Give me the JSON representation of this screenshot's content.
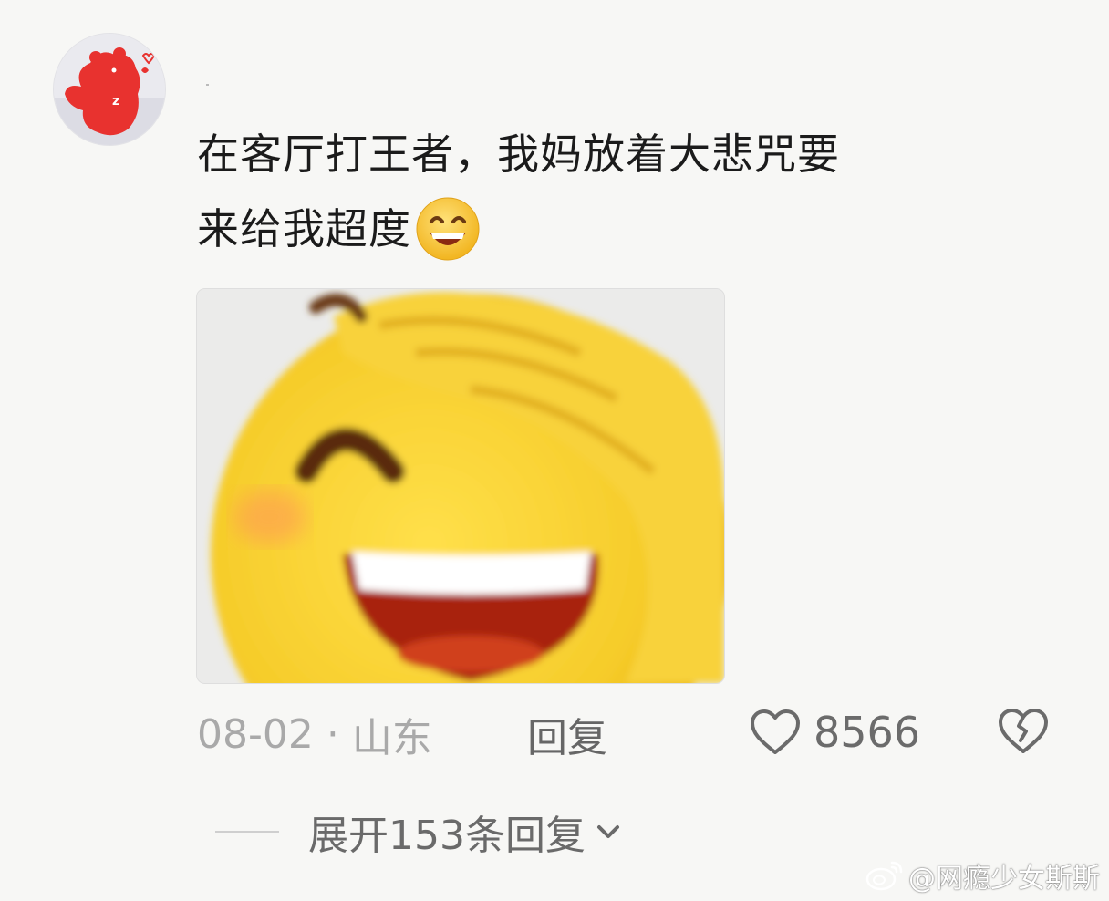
{
  "comment": {
    "text_line1": "在客厅打王者，我妈放着大悲咒要",
    "text_line2": "来给我超度",
    "inline_emoji": "grinning-face-icon"
  },
  "meta": {
    "date": "08-02",
    "separator": "·",
    "location": "山东",
    "reply_label": "回复",
    "like_count": "8566"
  },
  "replies": {
    "expand_label": "展开153条回复"
  },
  "watermark": {
    "text": "@网瘾少女斯斯"
  },
  "colors": {
    "background": "#f7f7f5",
    "text_primary": "#1b1b1b",
    "text_muted": "#a9a9a9",
    "text_secondary": "#6a6a6a",
    "avatar_bear": "#e8322f",
    "emoji_yellow": "#f7d23a"
  }
}
